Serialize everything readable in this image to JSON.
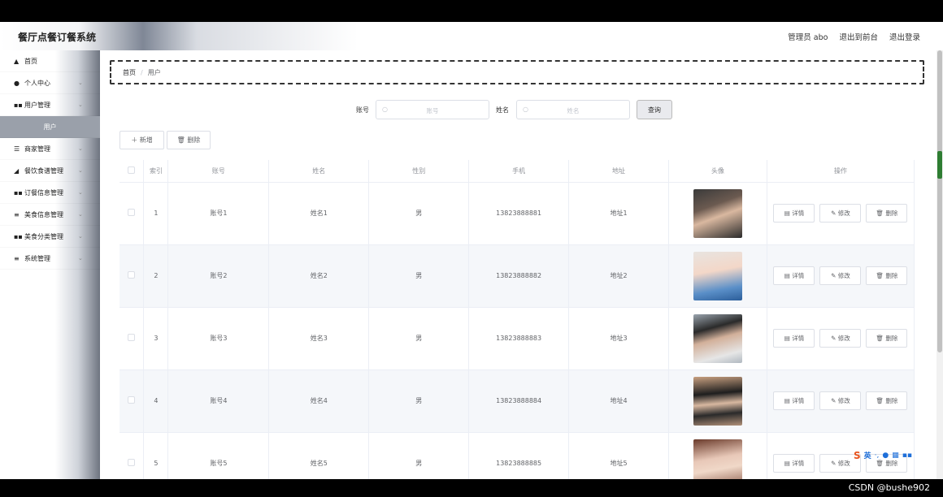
{
  "app": {
    "title": "餐厅点餐订餐系统"
  },
  "header": {
    "admin": "管理员 abo",
    "to_front": "退出到前台",
    "logout": "退出登录"
  },
  "sidebar": {
    "items": [
      {
        "label": "首页",
        "icon": "home-icon",
        "chev": false
      },
      {
        "label": "个人中心",
        "icon": "user-icon",
        "chev": true
      },
      {
        "label": "用户管理",
        "icon": "grid-icon",
        "chev": true
      },
      {
        "label": "用户",
        "icon": "",
        "chev": false,
        "active": true
      },
      {
        "label": "商家管理",
        "icon": "sliders-icon",
        "chev": true
      },
      {
        "label": "餐饮食谱管理",
        "icon": "thumb-icon",
        "chev": true
      },
      {
        "label": "订餐信息管理",
        "icon": "grid-icon",
        "chev": true
      },
      {
        "label": "美食信息管理",
        "icon": "list-icon",
        "chev": true
      },
      {
        "label": "美食分类管理",
        "icon": "grid-icon",
        "chev": true
      },
      {
        "label": "系统管理",
        "icon": "list-icon",
        "chev": true
      }
    ]
  },
  "breadcrumb": {
    "home": "首页",
    "sep": "/",
    "current": "用户"
  },
  "search": {
    "account_label": "账号",
    "account_placeholder": "账号",
    "name_label": "姓名",
    "name_placeholder": "姓名",
    "query": "查询"
  },
  "toolbar": {
    "add": "＋ 新增",
    "delete": "🗑 删除"
  },
  "table": {
    "headers": [
      "",
      "索引",
      "账号",
      "姓名",
      "性别",
      "手机",
      "地址",
      "头像",
      "操作"
    ],
    "rows": [
      {
        "index": "1",
        "account": "账号1",
        "name": "姓名1",
        "gender": "男",
        "phone": "13823888881",
        "address": "地址1"
      },
      {
        "index": "2",
        "account": "账号2",
        "name": "姓名2",
        "gender": "男",
        "phone": "13823888882",
        "address": "地址2"
      },
      {
        "index": "3",
        "account": "账号3",
        "name": "姓名3",
        "gender": "男",
        "phone": "13823888883",
        "address": "地址3"
      },
      {
        "index": "4",
        "account": "账号4",
        "name": "姓名4",
        "gender": "男",
        "phone": "13823888884",
        "address": "地址4"
      },
      {
        "index": "5",
        "account": "账号5",
        "name": "姓名5",
        "gender": "男",
        "phone": "13823888885",
        "address": "地址5"
      }
    ],
    "ops": {
      "detail": "详情",
      "edit": "修改",
      "delete": "删除"
    }
  },
  "watermark": "CSDN @bushe902",
  "ime": {
    "label": "英"
  }
}
